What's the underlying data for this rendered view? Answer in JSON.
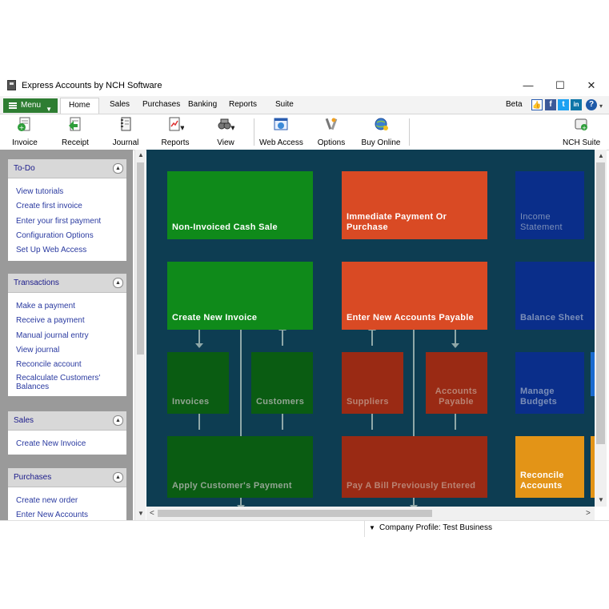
{
  "window": {
    "title": "Express Accounts by NCH Software",
    "minimize": "—",
    "maximize": "☐",
    "close": "✕"
  },
  "tabbar": {
    "menu_label": "Menu",
    "tabs": [
      "Home",
      "Sales",
      "Purchases",
      "Banking",
      "Reports",
      "Suite"
    ],
    "beta": "Beta"
  },
  "toolbar": {
    "items": [
      "Invoice",
      "Receipt",
      "Journal",
      "Reports",
      "View",
      "Web Access",
      "Options",
      "Buy Online",
      "NCH Suite"
    ]
  },
  "sidebar": {
    "panels": [
      {
        "title": "To-Do",
        "links": [
          "View tutorials",
          "Create first invoice",
          "Enter your first payment",
          "Configuration Options",
          "Set Up Web Access"
        ]
      },
      {
        "title": "Transactions",
        "links": [
          "Make a payment",
          "Receive a payment",
          "Manual journal entry",
          "View journal",
          "Reconcile account",
          "Recalculate Customers' Balances"
        ]
      },
      {
        "title": "Sales",
        "links": [
          "Create New Invoice"
        ]
      },
      {
        "title": "Purchases",
        "links": [
          "Create new order",
          "Enter New Accounts Payable"
        ]
      }
    ]
  },
  "flowchart": {
    "tiles": {
      "cash_sale": "Non-Invoiced Cash Sale",
      "immediate_payment": "Immediate Payment Or Purchase",
      "income_statement": "Income Statement",
      "create_invoice": "Create New Invoice",
      "accounts_payable_new": "Enter New Accounts Payable",
      "balance_sheet": "Balance Sheet",
      "invoices": "Invoices",
      "customers": "Customers",
      "suppliers": "Suppliers",
      "accounts_payable": "Accounts Payable",
      "manage_budgets": "Manage Budgets",
      "apply_payment": "Apply Customer's Payment",
      "pay_bill": "Pay A Bill Previously Entered",
      "reconcile": "Reconcile Accounts"
    },
    "colors": {
      "background": "#0d3d52",
      "green": "#0f8a1a",
      "dark_green": "#0a5c12",
      "orange": "#d94a24",
      "dark_red": "#9a2a14",
      "blue": "#0a2e8a",
      "amber": "#e39417"
    }
  },
  "statusbar": {
    "text": "Company Profile: Test Business"
  }
}
